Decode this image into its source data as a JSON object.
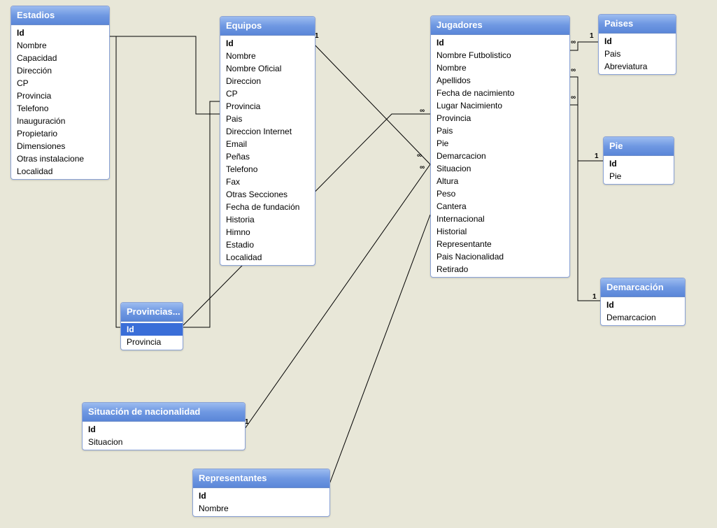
{
  "labels": {
    "one": "1",
    "many": "∞"
  },
  "tables": {
    "estadios": {
      "title": "Estadios",
      "fields": [
        "Id",
        "Nombre",
        "Capacidad",
        "Dirección",
        "CP",
        "Provincia",
        "Telefono",
        "Inauguración",
        "Propietario",
        "Dimensiones",
        "Otras instalacione",
        "Localidad"
      ]
    },
    "equipos": {
      "title": "Equipos",
      "fields": [
        "Id",
        "Nombre",
        "Nombre Oficial",
        "Direccion",
        "CP",
        "Provincia",
        "Pais",
        "Direccion Internet",
        "Email",
        "Peñas",
        "Telefono",
        "Fax",
        "Otras Secciones",
        "Fecha de fundación",
        "Historia",
        "Himno",
        "Estadio",
        "Localidad"
      ]
    },
    "jugadores": {
      "title": "Jugadores",
      "fields": [
        "Id",
        "Nombre Futbolistico",
        "Nombre",
        "Apellidos",
        "Fecha de nacimiento",
        "Lugar Nacimiento",
        "Provincia",
        "Pais",
        "Pie",
        "Demarcacion",
        "Situacion",
        "Altura",
        "Peso",
        "Cantera",
        "Internacional",
        "Historial",
        "Representante",
        "Pais Nacionalidad",
        "Retirado"
      ]
    },
    "paises": {
      "title": "Paises",
      "fields": [
        "Id",
        "Pais",
        "Abreviatura"
      ]
    },
    "pie": {
      "title": "Pie",
      "fields": [
        "Id",
        "Pie"
      ]
    },
    "demarcacion": {
      "title": "Demarcación",
      "fields": [
        "Id",
        "Demarcacion"
      ]
    },
    "provincias": {
      "title": "Provincias...",
      "fields": [
        "Id",
        "Provincia"
      ]
    },
    "situacion": {
      "title": "Situación de nacionalidad",
      "fields": [
        "Id",
        "Situacion"
      ]
    },
    "representantes": {
      "title": "Representantes",
      "fields": [
        "Id",
        "Nombre"
      ]
    }
  },
  "relationships": [
    {
      "from": "estadios.Provincia",
      "to": "provincias.Id",
      "cardinality": "many-to-one"
    },
    {
      "from": "equipos.Provincia",
      "to": "provincias.Id",
      "cardinality": "many-to-one"
    },
    {
      "from": "equipos.Estadio",
      "to": "estadios.Id",
      "cardinality": "many-to-one"
    },
    {
      "from": "jugadores.Cantera",
      "to": "equipos.Id",
      "cardinality": "many-to-one"
    },
    {
      "from": "jugadores.Provincia",
      "to": "provincias.Id",
      "cardinality": "many-to-one"
    },
    {
      "from": "jugadores.Situacion",
      "to": "situacion.Id",
      "cardinality": "many-to-one"
    },
    {
      "from": "jugadores.Representante",
      "to": "representantes.Id",
      "cardinality": "many-to-one"
    },
    {
      "from": "jugadores.Pais",
      "to": "paises.Id",
      "cardinality": "many-to-one"
    },
    {
      "from": "jugadores.Pie",
      "to": "pie.Id",
      "cardinality": "many-to-one"
    },
    {
      "from": "jugadores.Demarcacion",
      "to": "demarcacion.Id",
      "cardinality": "many-to-one"
    }
  ]
}
